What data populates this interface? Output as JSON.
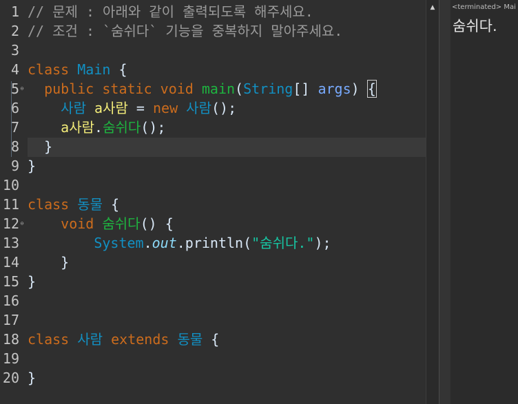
{
  "editor": {
    "line_numbers": [
      "1",
      "2",
      "3",
      "4",
      "5",
      "6",
      "7",
      "8",
      "9",
      "10",
      "11",
      "12",
      "13",
      "14",
      "15",
      "16",
      "17",
      "18",
      "19",
      "20"
    ],
    "lines": [
      [
        {
          "t": "// 문제 : 아래와 같이 출력되도록 해주세요.",
          "c": "comment"
        }
      ],
      [
        {
          "t": "// 조건 : `숨쉬다` 기능을 중복하지 말아주세요.",
          "c": "comment"
        }
      ],
      [],
      [
        {
          "t": "class ",
          "c": "kw"
        },
        {
          "t": "Main",
          "c": "type"
        },
        {
          "t": " {",
          "c": "plain"
        }
      ],
      [
        {
          "t": "  public static void ",
          "c": "kw"
        },
        {
          "t": "main",
          "c": "method"
        },
        {
          "t": "(",
          "c": "plain"
        },
        {
          "t": "String",
          "c": "type"
        },
        {
          "t": "[] ",
          "c": "plain"
        },
        {
          "t": "args",
          "c": "param"
        },
        {
          "t": ") ",
          "c": "plain"
        },
        {
          "t": "{",
          "c": "plain",
          "b": true
        }
      ],
      [
        {
          "t": "    ",
          "c": "plain"
        },
        {
          "t": "사람",
          "c": "type"
        },
        {
          "t": " ",
          "c": "plain"
        },
        {
          "t": "a사람",
          "c": "var"
        },
        {
          "t": " = ",
          "c": "plain"
        },
        {
          "t": "new ",
          "c": "kw"
        },
        {
          "t": "사람",
          "c": "type"
        },
        {
          "t": "();",
          "c": "plain"
        }
      ],
      [
        {
          "t": "    ",
          "c": "plain"
        },
        {
          "t": "a사람",
          "c": "var"
        },
        {
          "t": ".",
          "c": "plain"
        },
        {
          "t": "숨쉬다",
          "c": "method"
        },
        {
          "t": "();",
          "c": "plain"
        }
      ],
      [
        {
          "t": "  }",
          "c": "plain"
        }
      ],
      [
        {
          "t": "}",
          "c": "plain"
        }
      ],
      [],
      [
        {
          "t": "class ",
          "c": "kw"
        },
        {
          "t": "동물",
          "c": "type"
        },
        {
          "t": " {",
          "c": "plain"
        }
      ],
      [
        {
          "t": "    void ",
          "c": "kw"
        },
        {
          "t": "숨쉬다",
          "c": "method"
        },
        {
          "t": "() {",
          "c": "plain"
        }
      ],
      [
        {
          "t": "        ",
          "c": "plain"
        },
        {
          "t": "System",
          "c": "type"
        },
        {
          "t": ".",
          "c": "plain"
        },
        {
          "t": "out",
          "c": "field"
        },
        {
          "t": ".",
          "c": "plain"
        },
        {
          "t": "println(",
          "c": "plain"
        },
        {
          "t": "\"숨쉬다.\"",
          "c": "str"
        },
        {
          "t": ");",
          "c": "plain"
        }
      ],
      [
        {
          "t": "    }",
          "c": "plain"
        }
      ],
      [
        {
          "t": "}",
          "c": "plain"
        }
      ],
      [],
      [],
      [
        {
          "t": "class ",
          "c": "kw"
        },
        {
          "t": "사람",
          "c": "type"
        },
        {
          "t": " ",
          "c": "plain"
        },
        {
          "t": "extends ",
          "c": "kw"
        },
        {
          "t": "동물",
          "c": "type"
        },
        {
          "t": " {",
          "c": "plain"
        }
      ],
      [],
      [
        {
          "t": "}",
          "c": "plain"
        }
      ]
    ],
    "fold_markers": [
      "5",
      "12"
    ]
  },
  "scrollbar": {
    "up_arrow_icon": "chevron-up-icon"
  },
  "console": {
    "header": "<terminated> Mai",
    "output": "숨쉬다."
  }
}
